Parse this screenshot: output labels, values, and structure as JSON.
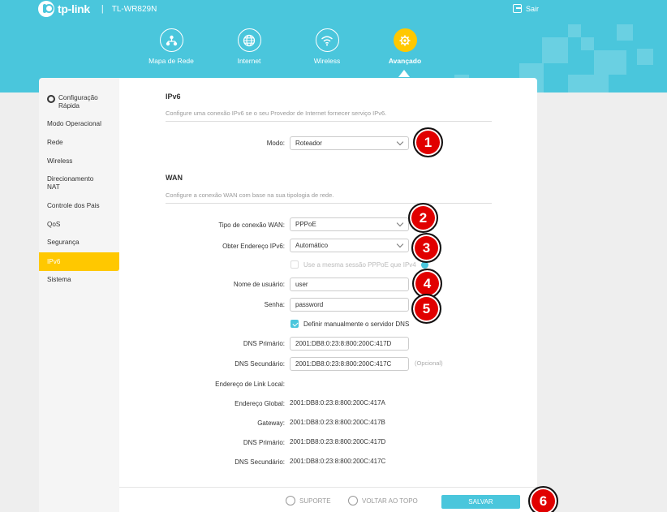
{
  "header": {
    "logo_text": "tp-link",
    "separator": "|",
    "model": "TL-WR829N",
    "logout_label": "Sair"
  },
  "nav": [
    {
      "label": "Mapa de Rede",
      "icon": "network-map-icon"
    },
    {
      "label": "Internet",
      "icon": "globe-icon"
    },
    {
      "label": "Wireless",
      "icon": "wifi-icon"
    },
    {
      "label": "Avançado",
      "icon": "gear-icon",
      "active": true
    }
  ],
  "sidebar": {
    "items": [
      {
        "label": "Configuração Rápida"
      },
      {
        "label": "Modo Operacional"
      },
      {
        "label": "Rede"
      },
      {
        "label": "Wireless"
      },
      {
        "label": "Direcionamento NAT"
      },
      {
        "label": "Controle dos Pais"
      },
      {
        "label": "QoS"
      },
      {
        "label": "Segurança"
      },
      {
        "label": "IPv6",
        "active": true
      },
      {
        "label": "Sistema"
      }
    ]
  },
  "ipv6": {
    "title": "IPv6",
    "description": "Configure uma conexão IPv6 se o seu Provedor de Internet fornecer serviço IPv6.",
    "mode_label": "Modo:",
    "mode_value": "Roteador"
  },
  "wan": {
    "title": "WAN",
    "description": "Configure a conexão WAN com base na sua tipologia de rede.",
    "conn_type_label": "Tipo de conexão WAN:",
    "conn_type_value": "PPPoE",
    "get_addr_label": "Obter Endereço IPv6:",
    "get_addr_value": "Automático",
    "same_session_label": "Use a mesma sessão PPPoE que IPv4",
    "username_label": "Nome de usuário:",
    "username_value": "user",
    "password_label": "Senha:",
    "password_value": "password",
    "manual_dns_label": "Definir manualmente o servidor DNS",
    "dns_primary_label": "DNS Primário:",
    "dns_primary_value": "2001:DB8:0:23:8:800:200C:417D",
    "dns_secondary_label": "DNS Secundário:",
    "dns_secondary_value": "2001:DB8:0:23:8:800:200C:417C",
    "optional_label": "(Opcional)",
    "link_local_label": "Endereço de Link Local:",
    "global_label": "Endereço Global:",
    "global_value": "2001:DB8:0:23:8:800:200C:417A",
    "gateway_label": "Gateway:",
    "gateway_value": "2001:DB8:0:23:8:800:200C:417B",
    "status_dns_primary_label": "DNS Primário:",
    "status_dns_primary_value": "2001:DB8:0:23:8:800:200C:417D",
    "status_dns_secondary_label": "DNS Secundário:",
    "status_dns_secondary_value": "2001:DB8:0:23:8:800:200C:417C"
  },
  "footer": {
    "support_label": "SUPORTE",
    "top_label": "VOLTAR AO TOPO",
    "save_label": "SALVAR"
  },
  "annotations": [
    "1",
    "2",
    "3",
    "4",
    "5",
    "6"
  ],
  "colors": {
    "brand": "#4ac6dc",
    "accent": "#ffc800",
    "badge": "#e10000"
  }
}
